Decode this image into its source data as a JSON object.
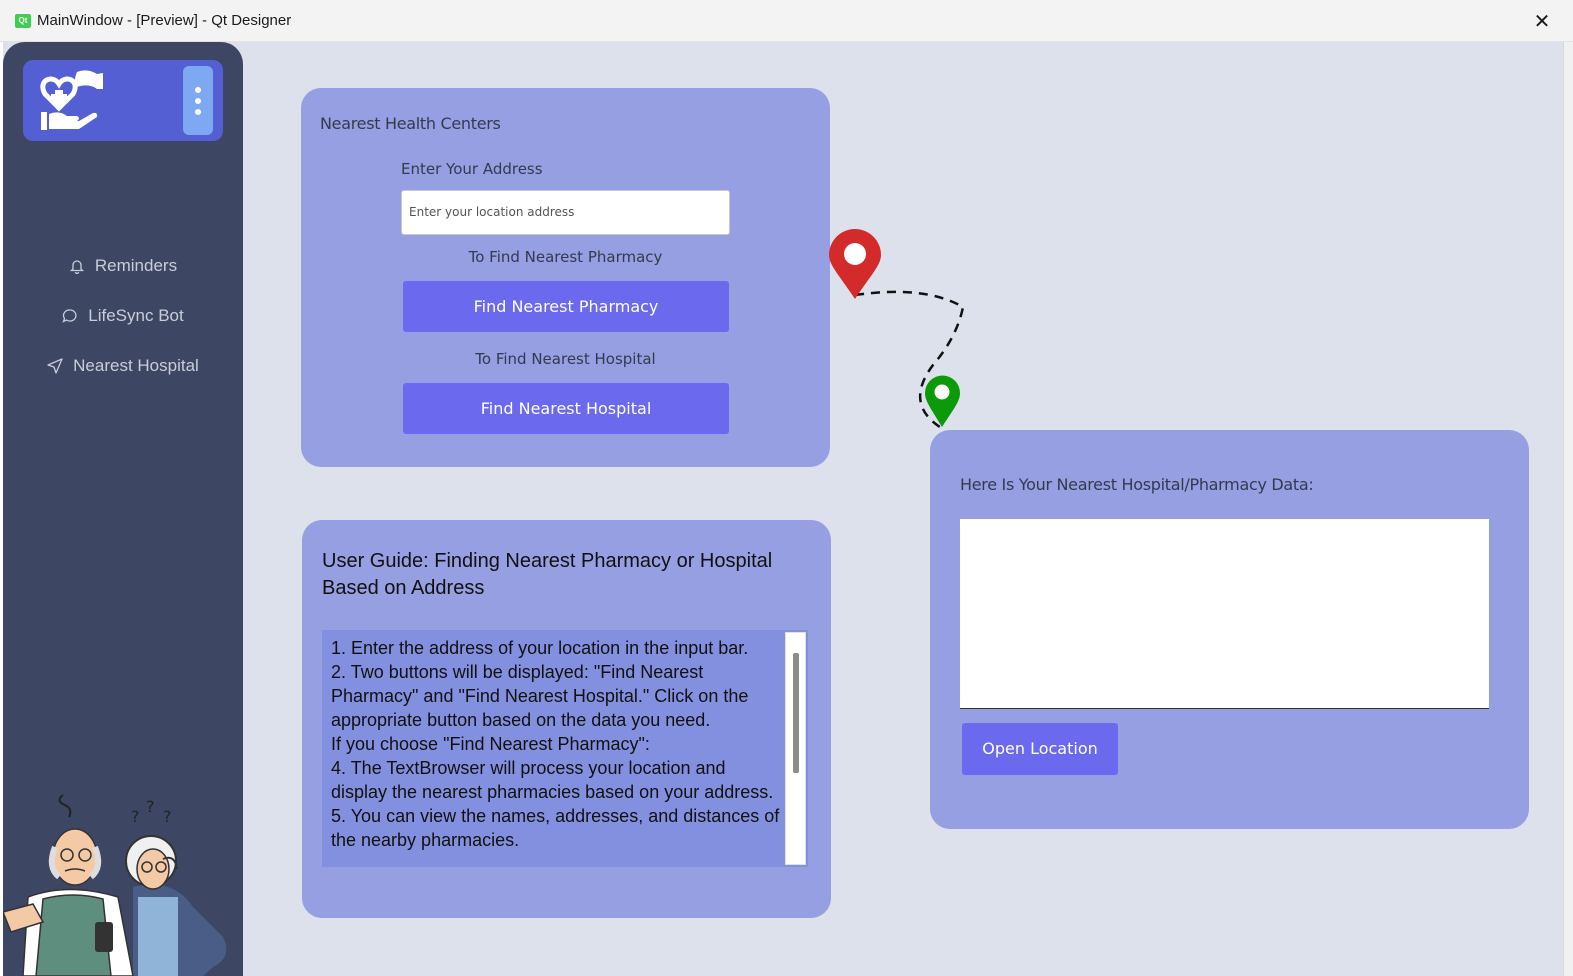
{
  "window": {
    "title": "MainWindow - [Preview] - Qt Designer",
    "app_icon_text": "Qt",
    "close_glyph": "✕"
  },
  "sidebar": {
    "logo_icon": "hand-heart-care-icon",
    "menu_icon": "vertical-dots-icon",
    "items": [
      {
        "label": "Reminders",
        "icon": "bell-icon"
      },
      {
        "label": "LifeSync Bot",
        "icon": "chat-bubble-icon"
      },
      {
        "label": "Nearest Hospital",
        "icon": "navigation-arrow-icon"
      }
    ],
    "illustration": "confused-elderly-couple-with-phone"
  },
  "health_centers": {
    "title": "Nearest Health Centers",
    "address_label": "Enter Your Address",
    "address_placeholder": "Enter your location address",
    "pharmacy_hint": "To Find Nearest Pharmacy",
    "pharmacy_button": "Find Nearest Pharmacy",
    "hospital_hint": "To Find Nearest Hospital",
    "hospital_button": "Find Nearest Hospital"
  },
  "guide": {
    "title": "User Guide: Finding Nearest Pharmacy or Hospital Based on Address",
    "lines": [
      "1. Enter the address of your location in the input bar.",
      "2. Two buttons will be displayed: \"Find Nearest Pharmacy\" and \"Find Nearest Hospital.\" Click on the appropriate button based on the data you need.",
      "If you choose \"Find Nearest Pharmacy\":",
      "4. The TextBrowser will process your location and display the nearest pharmacies based on your address.",
      "5. You can view the names, addresses, and distances of the nearby pharmacies."
    ]
  },
  "results": {
    "title": "Here Is Your Nearest Hospital/Pharmacy Data:",
    "content": "",
    "open_button": "Open Location"
  },
  "colors": {
    "sidebar": "#3d4663",
    "logo_box": "#545fd4",
    "card": "#959fe2",
    "button": "#6b69ee",
    "background": "#dde1ec",
    "pin_red": "#d32b2b",
    "pin_green": "#0a9a0a"
  },
  "map_decoration": {
    "start_pin": "map-pin-red-icon",
    "end_pin": "map-pin-green-icon",
    "route": "dashed-route"
  }
}
